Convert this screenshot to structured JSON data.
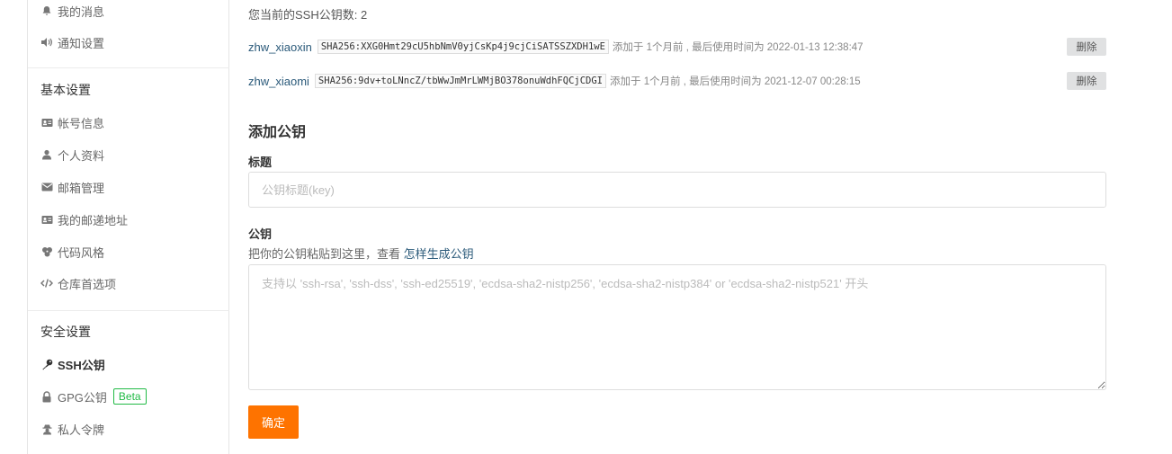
{
  "sidebar": {
    "top_items": [
      {
        "label": "我的消息",
        "icon": "bell-icon"
      },
      {
        "label": "通知设置",
        "icon": "volume-icon"
      }
    ],
    "basic_header": "基本设置",
    "basic_items": [
      {
        "label": "帐号信息",
        "icon": "id-card-icon"
      },
      {
        "label": "个人资料",
        "icon": "user-icon"
      },
      {
        "label": "邮箱管理",
        "icon": "envelope-icon"
      },
      {
        "label": "我的邮递地址",
        "icon": "address-card-icon"
      },
      {
        "label": "代码风格",
        "icon": "palette-icon"
      },
      {
        "label": "仓库首选项",
        "icon": "code-icon"
      }
    ],
    "security_header": "安全设置",
    "security_items": [
      {
        "label": "SSH公钥",
        "icon": "key-icon",
        "active": true
      },
      {
        "label": "GPG公钥",
        "icon": "lock-icon",
        "badge": "Beta"
      },
      {
        "label": "私人令牌",
        "icon": "user-secret-icon"
      }
    ]
  },
  "main": {
    "count_text": "您当前的SSH公钥数: 2",
    "keys": [
      {
        "name": "zhw_xiaoxin",
        "fingerprint": "SHA256:XXG0Hmt29cU5hbNmV0yjCsKp4j9cjCiSATSSZXDH1wE",
        "meta": "添加于 1个月前 , 最后使用时间为 2022-01-13 12:38:47",
        "delete_label": "删除"
      },
      {
        "name": "zhw_xiaomi",
        "fingerprint": "SHA256:9dv+toLNncZ/tbWwJmMrLWMjBO378onuWdhFQCjCDGI",
        "meta": "添加于 1个月前 , 最后使用时间为 2021-12-07 00:28:15",
        "delete_label": "删除"
      }
    ],
    "add_title": "添加公钥",
    "title_label": "标题",
    "title_placeholder": "公钥标题(key)",
    "title_value": "",
    "key_label": "公钥",
    "help_prefix": "把你的公钥粘贴到这里，查看 ",
    "help_link": "怎样生成公钥",
    "key_placeholder": "支持以 'ssh-rsa', 'ssh-dss', 'ssh-ed25519', 'ecdsa-sha2-nistp256', 'ecdsa-sha2-nistp384' or 'ecdsa-sha2-nistp521' 开头",
    "key_value": "",
    "submit_label": "确定"
  },
  "colors": {
    "accent": "#fe7300",
    "link": "#2b5a7a",
    "beta": "#21ba45"
  }
}
